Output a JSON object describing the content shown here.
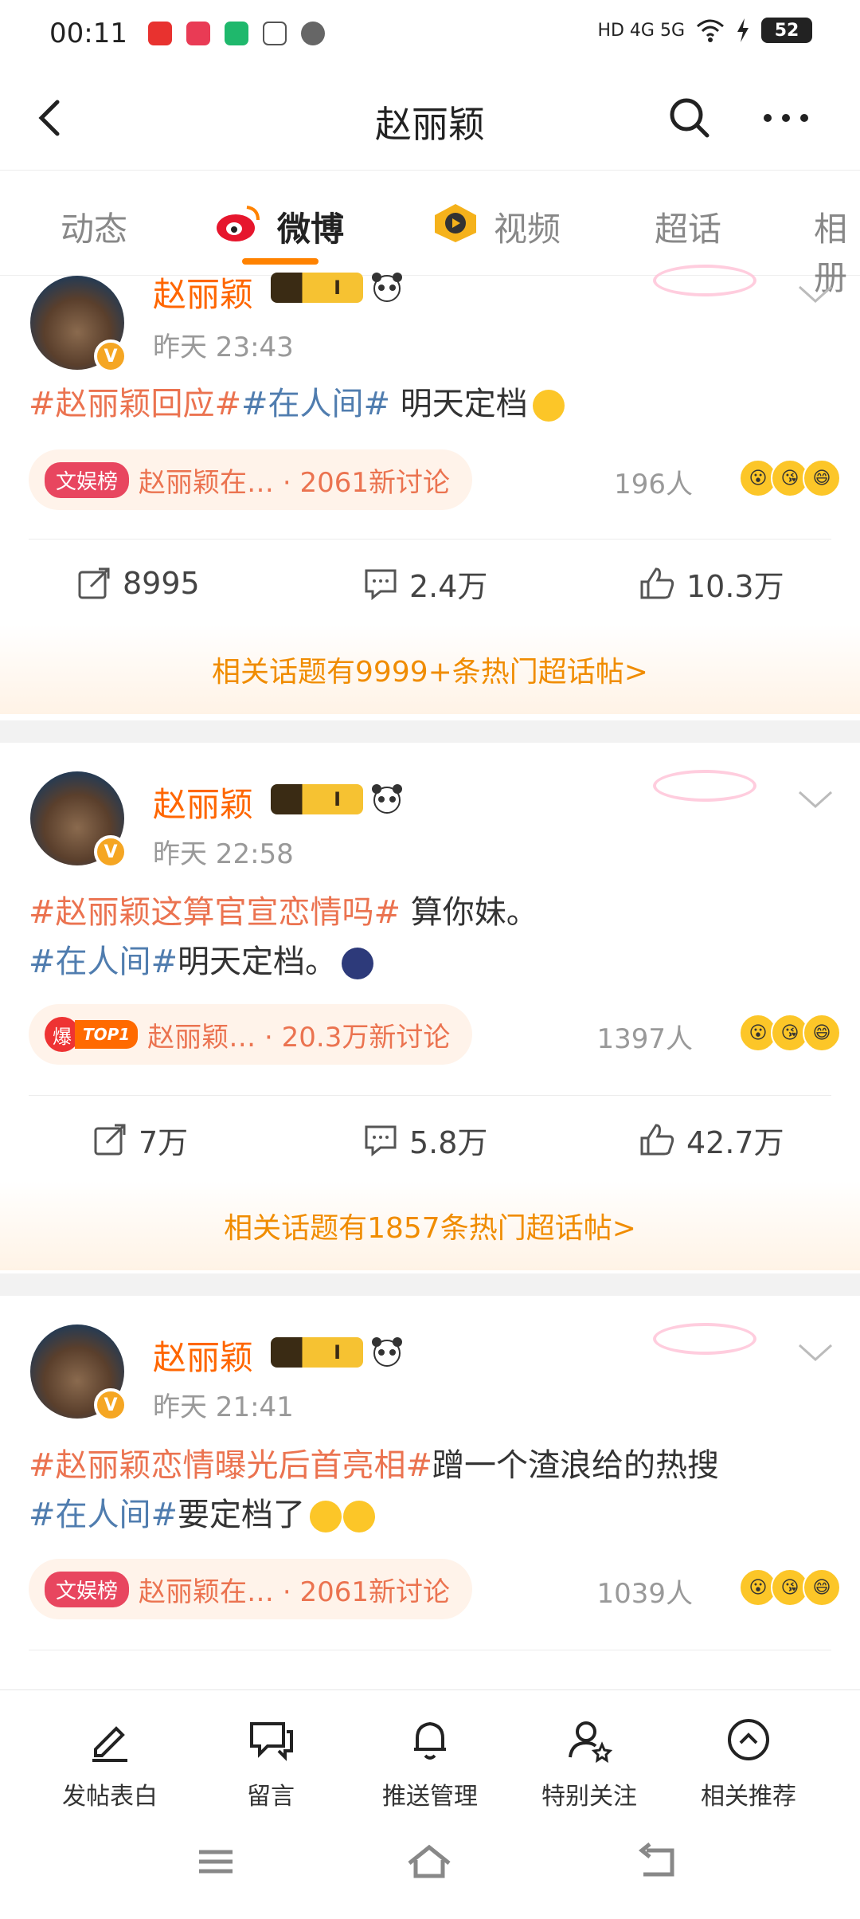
{
  "status_bar": {
    "time": "00:11",
    "battery": "52",
    "network": "HD 4G 5G"
  },
  "nav": {
    "title": "赵丽颖"
  },
  "tabs": [
    {
      "label": "动态"
    },
    {
      "label": "微博"
    },
    {
      "label": "视频"
    },
    {
      "label": "超话"
    },
    {
      "label": "相册"
    }
  ],
  "posts": [
    {
      "author": "赵丽颖",
      "level": "I",
      "time": "昨天 23:43",
      "content_parts": [
        "#赵丽颖回应#",
        "#在人间#",
        " 明天定档"
      ],
      "chip_badge": "文娱榜",
      "chip_text": "赵丽颖在… · 2061新讨论",
      "people": "196人",
      "repost": "8995",
      "comment": "2.4万",
      "like": "10.3万",
      "related": "相关话题有9999+条热门超话帖>"
    },
    {
      "author": "赵丽颖",
      "level": "I",
      "time": "昨天 22:58",
      "content_parts": [
        "#赵丽颖这算官宣恋情吗#",
        " 算你妹。",
        "#在人间#",
        "明天定档。"
      ],
      "chip_badge": "爆",
      "chip_top": "TOP1",
      "chip_text": "赵丽颖… · 20.3万新讨论",
      "people": "1397人",
      "repost": "7万",
      "comment": "5.8万",
      "like": "42.7万",
      "related": "相关话题有1857条热门超话帖>"
    },
    {
      "author": "赵丽颖",
      "level": "I",
      "time": "昨天 21:41",
      "content_parts": [
        "#赵丽颖恋情曝光后首亮相#",
        "蹭一个渣浪给的热搜",
        "#在人间#",
        "要定档了"
      ],
      "chip_badge": "文娱榜",
      "chip_text": "赵丽颖在… · 2061新讨论",
      "people": "1039人"
    }
  ],
  "bottom_bar": [
    {
      "label": "发帖表白"
    },
    {
      "label": "留言"
    },
    {
      "label": "推送管理"
    },
    {
      "label": "特别关注"
    },
    {
      "label": "相关推荐"
    }
  ],
  "colors": {
    "accent": "#ff8200",
    "topic_orange": "#eb7350",
    "topic_blue": "#507daf"
  }
}
